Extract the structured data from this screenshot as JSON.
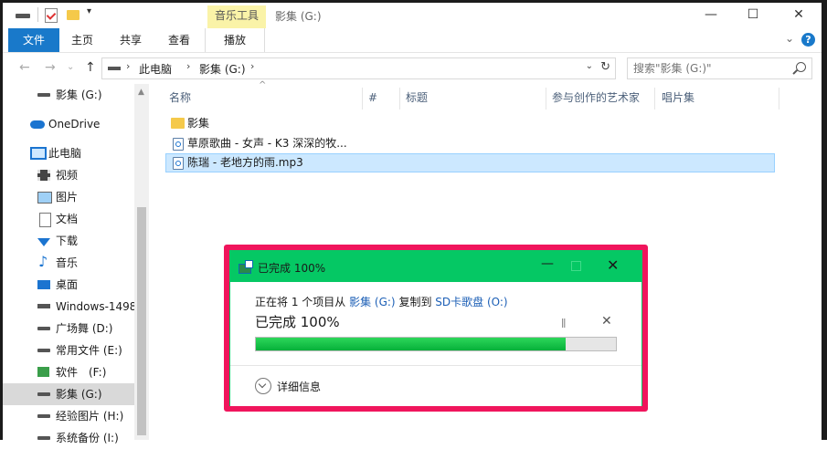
{
  "titlebar": {
    "tool_tab": "音乐工具",
    "title": "影集 (G:)",
    "minimize": "—",
    "maximize": "☐",
    "close": "✕"
  },
  "ribbon": {
    "tabs": [
      "文件",
      "主页",
      "共享",
      "查看",
      "播放"
    ],
    "expand_icon": "chevron-down-icon",
    "help": "?"
  },
  "address": {
    "segments": [
      "此电脑",
      "影集 (G:)"
    ],
    "search_placeholder": "搜索\"影集 (G:)\""
  },
  "nav": {
    "items": [
      {
        "label": "影集 (G:)",
        "icon": "drive-icon"
      },
      {
        "label": "OneDrive",
        "icon": "onedrive-icon"
      },
      {
        "label": "此电脑",
        "icon": "this-pc-icon"
      },
      {
        "label": "视频",
        "icon": "video-icon"
      },
      {
        "label": "图片",
        "icon": "pictures-icon"
      },
      {
        "label": "文档",
        "icon": "documents-icon"
      },
      {
        "label": "下载",
        "icon": "downloads-icon"
      },
      {
        "label": "音乐",
        "icon": "music-icon"
      },
      {
        "label": "桌面",
        "icon": "desktop-icon"
      },
      {
        "label": "Windows-1498",
        "icon": "drive-icon"
      },
      {
        "label": "广场舞 (D:)",
        "icon": "drive-icon"
      },
      {
        "label": "常用文件 (E:)",
        "icon": "drive-icon"
      },
      {
        "label": "软件　(F:)",
        "icon": "drive-icon"
      },
      {
        "label": "影集 (G:)",
        "icon": "drive-icon"
      },
      {
        "label": "经验图片 (H:)",
        "icon": "drive-icon"
      },
      {
        "label": "系统备份 (I:)",
        "icon": "drive-icon"
      }
    ],
    "selected_index": 13
  },
  "columns": [
    "名称",
    "#",
    "标题",
    "参与创作的艺术家",
    "唱片集"
  ],
  "files": [
    {
      "name": "影集",
      "icon": "folder-icon"
    },
    {
      "name": "草原歌曲 - 女声 - K3 深深的牧...",
      "icon": "audio-file-icon"
    },
    {
      "name": "陈瑞 - 老地方的雨.mp3",
      "icon": "audio-file-icon"
    }
  ],
  "dialog": {
    "title": "已完成 100%",
    "line_prefix": "正在将 1 个项目从 ",
    "source": "影集 (G:)",
    "line_mid": " 复制到 ",
    "dest": "SD卡歌盘 (O:)",
    "status": "已完成 100%",
    "progress": 0.86,
    "details": "详细信息",
    "accent": "#05c864",
    "outline": "#f0155c"
  }
}
